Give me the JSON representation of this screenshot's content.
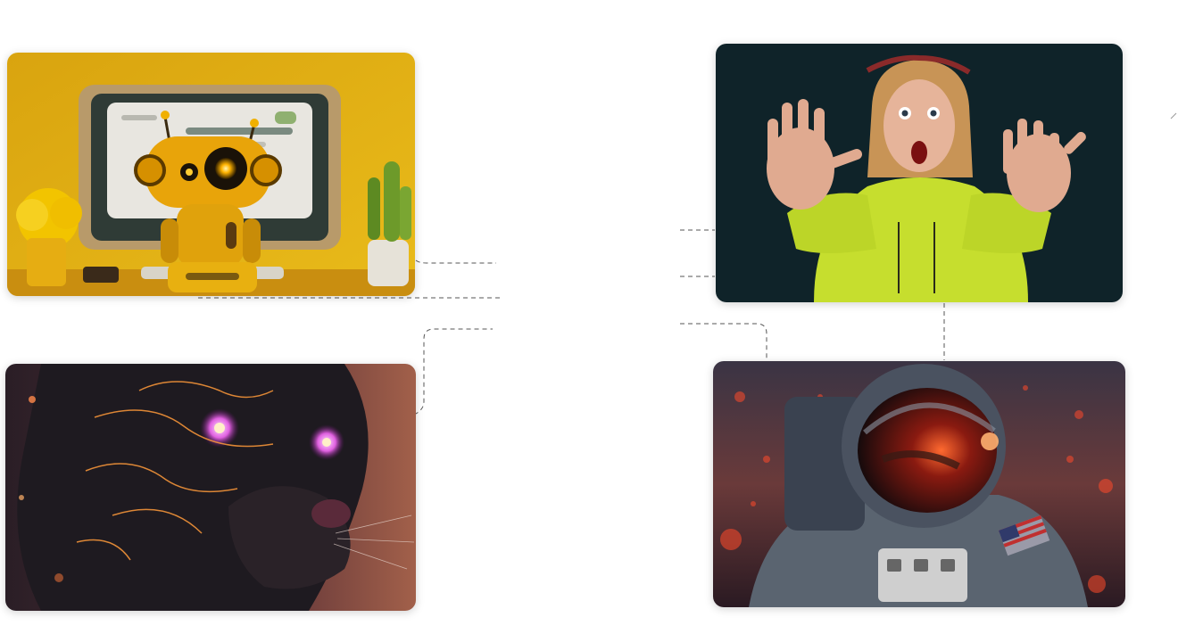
{
  "cards": [
    {
      "name": "robot",
      "subject": "yellow-robot-at-desk",
      "accent": "#e8b21a"
    },
    {
      "name": "panther",
      "subject": "neon-panther-portrait",
      "accent": "#b04a8c"
    },
    {
      "name": "woman",
      "subject": "surprised-woman-in-hoodie",
      "accent": "#c9e82a"
    },
    {
      "name": "astronaut",
      "subject": "astronaut-with-red-bokeh",
      "accent": "#d8402a"
    }
  ],
  "connector_color": "#555555"
}
